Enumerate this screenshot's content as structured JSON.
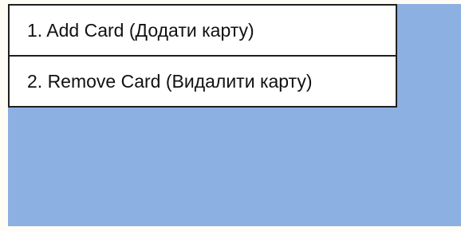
{
  "colors": {
    "page_background": "#fffcf6",
    "panel_background": "#8db0e2",
    "menu_background": "#ffffff",
    "menu_border": "#1f1f1f",
    "text": "#111111"
  },
  "menu": {
    "items": [
      {
        "label": "1. Add Card (Додати карту)"
      },
      {
        "label": "2. Remove Card (Видалити карту)"
      }
    ]
  }
}
